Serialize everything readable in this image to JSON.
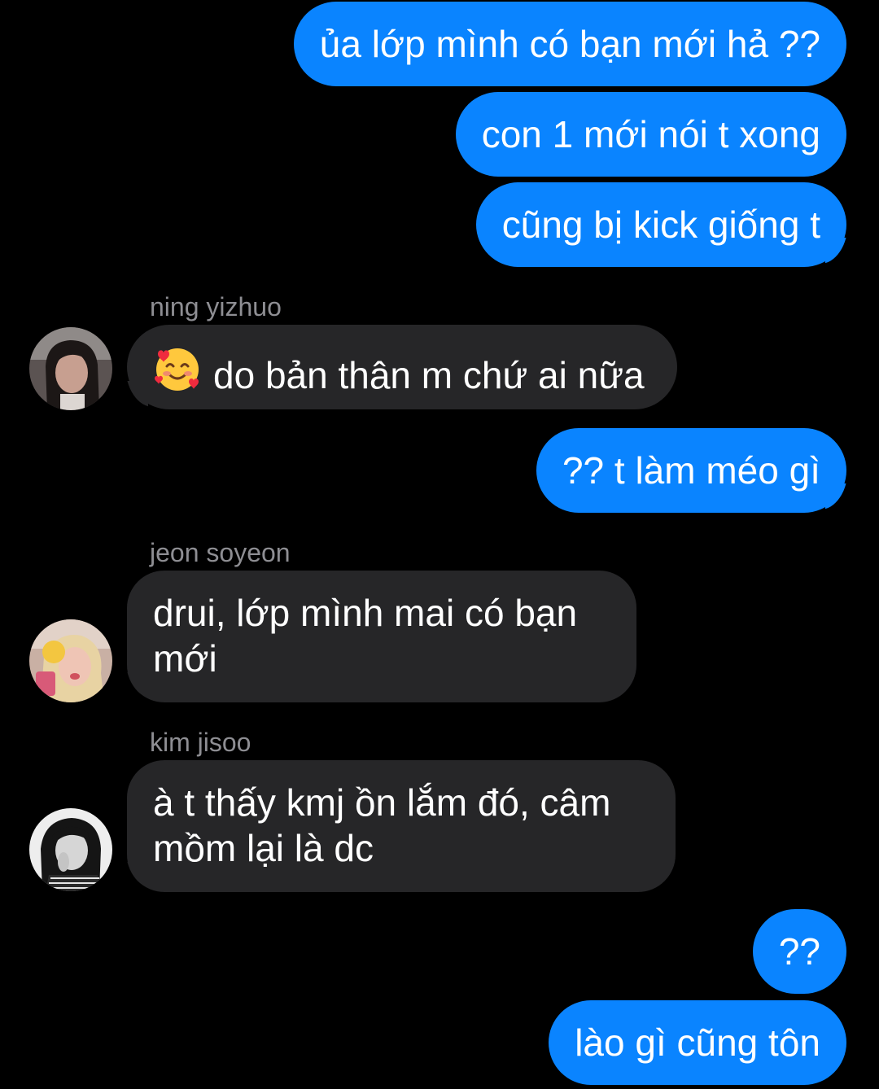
{
  "messages": {
    "m1": {
      "text": "ủa lớp mình có bạn mới hả ??"
    },
    "m2": {
      "text": "con 1 mới nói t xong"
    },
    "m3": {
      "text": "cũng bị kick giống t"
    },
    "m4": {
      "sender": "ning yizhuo",
      "emoji": "smiling-face-with-hearts",
      "text": "do bản thân m chứ ai nữa"
    },
    "m5": {
      "text": "?? t làm méo gì"
    },
    "m6": {
      "sender": "jeon soyeon",
      "line1": "drui, lớp mình mai có bạn",
      "line2": "mới"
    },
    "m7": {
      "sender": "kim jisoo",
      "line1": "à t thấy kmj ồn lắm đó, câm",
      "line2": "mồm lại là dc"
    },
    "m8": {
      "text": "??"
    },
    "m9": {
      "text": "lào gì cũng tôn"
    }
  },
  "colors": {
    "background": "#000000",
    "outgoing_bubble": "#0a84ff",
    "incoming_bubble": "#262628",
    "sender_name": "#8e8e93",
    "text": "#ffffff"
  }
}
